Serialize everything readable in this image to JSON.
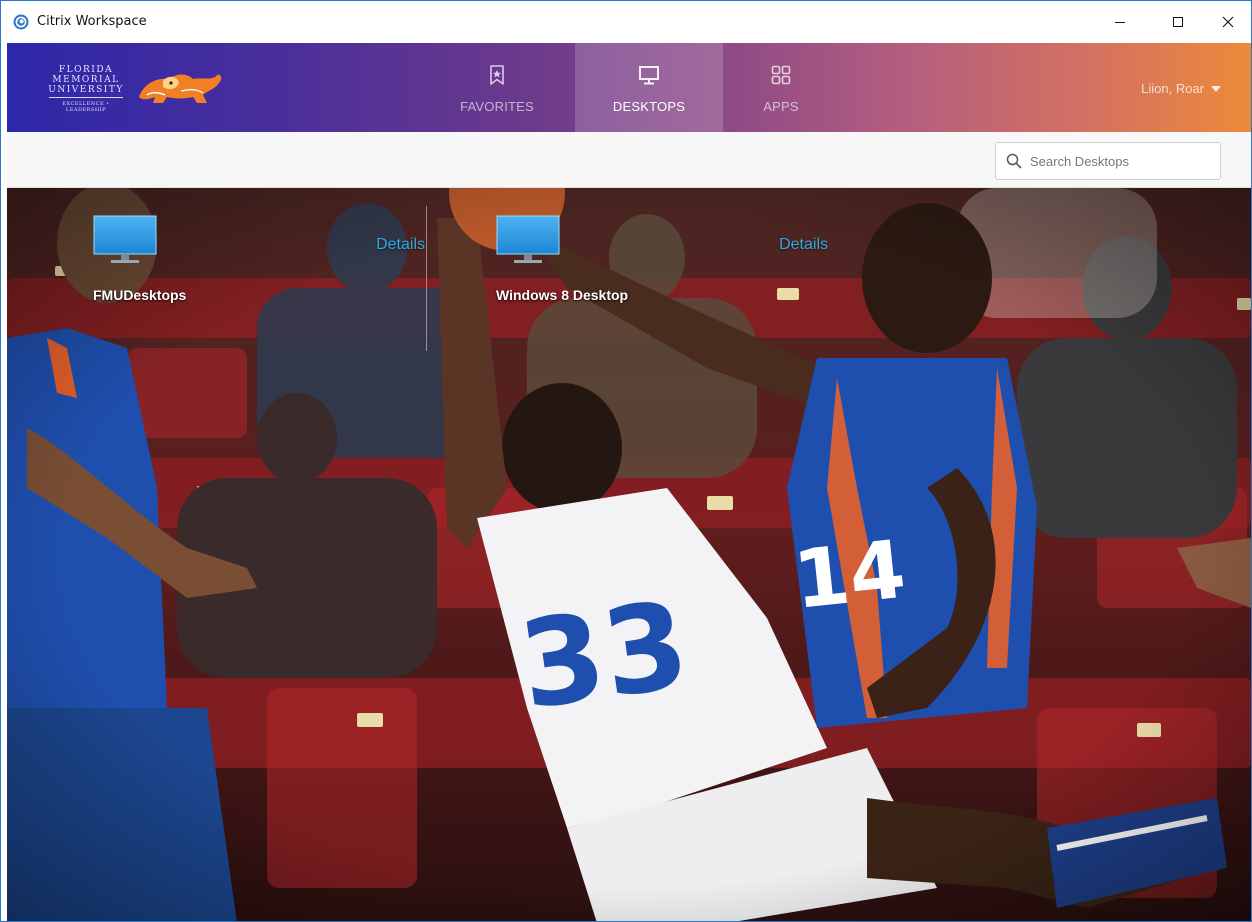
{
  "window": {
    "title": "Citrix Workspace",
    "icon": "citrix-logo-icon",
    "controls": [
      "minimize-icon",
      "maximize-icon",
      "close-icon"
    ]
  },
  "brand": {
    "logo_lines": [
      "FLORIDA",
      "MEMORIAL",
      "UNIVERSITY",
      "EXCELLENCE • LEADERSHIP"
    ],
    "mascot": "lion-mascot",
    "gradient_colors": [
      "#2d27a9",
      "#6c3a8c",
      "#b35e7e",
      "#ec8a3a"
    ]
  },
  "nav": {
    "tabs": [
      {
        "label": "FAVORITES",
        "icon": "star-bookmark-icon",
        "active": false
      },
      {
        "label": "DESKTOPS",
        "icon": "monitor-icon",
        "active": true
      },
      {
        "label": "APPS",
        "icon": "grid-icon",
        "active": false
      }
    ]
  },
  "user": {
    "name": "Liion, Roar"
  },
  "search": {
    "placeholder": "Search Desktops",
    "value": ""
  },
  "desktops": [
    {
      "name": "FMUDesktops",
      "details_label": "Details",
      "icon": "monitor-icon"
    },
    {
      "name": "Windows 8 Desktop",
      "details_label": "Details",
      "icon": "monitor-icon"
    }
  ],
  "background": {
    "description_icon": "basketball-photo"
  },
  "colors": {
    "link": "#2ea8e0",
    "active_tab_overlay": "rgba(255,255,255,0.18)"
  }
}
